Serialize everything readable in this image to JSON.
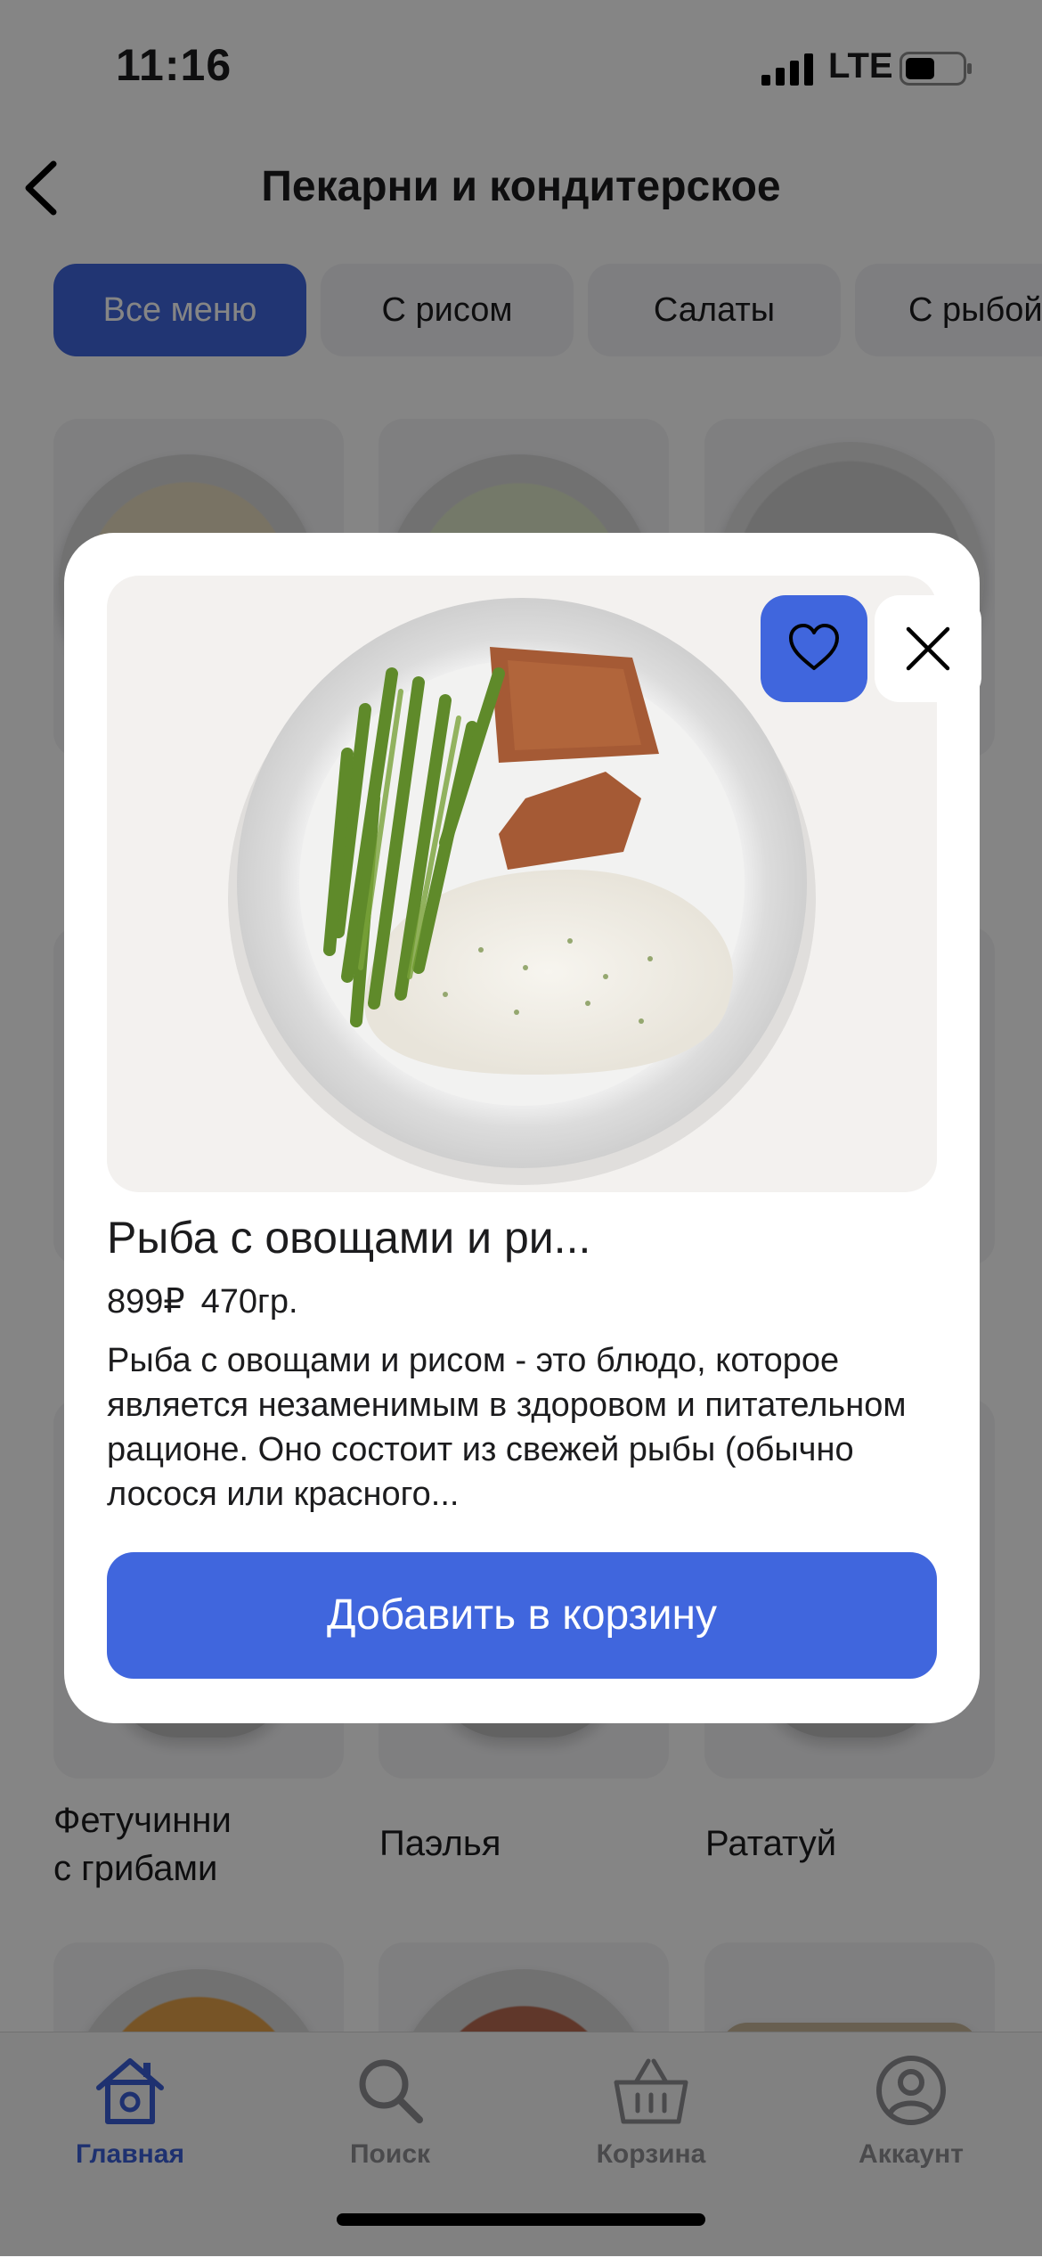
{
  "status": {
    "time": "11:16",
    "network": "LTE"
  },
  "header": {
    "title": "Пекарни и кондитерское"
  },
  "chips": [
    "Все меню",
    "С рисом",
    "Салаты",
    "С рыбой"
  ],
  "grid": {
    "row3_labels": [
      "Фетучинни\nс грибами",
      "Паэлья",
      "Рататуй"
    ]
  },
  "tabs": [
    "Главная",
    "Поиск",
    "Корзина",
    "Аккаунт"
  ],
  "modal": {
    "title": "Рыба с овощами и ри...",
    "price": "899₽",
    "weight": "470гр.",
    "description": "Рыба с овощами и рисом - это блюдо, которое является незаменимым в здоровом и питательном рационе. Оно состоит из свежей рыбы (обычно лосося или красного...",
    "add_button": "Добавить в корзину"
  },
  "colors": {
    "accent": "#4066dd",
    "overlay": "rgba(0,0,0,0.48)"
  }
}
